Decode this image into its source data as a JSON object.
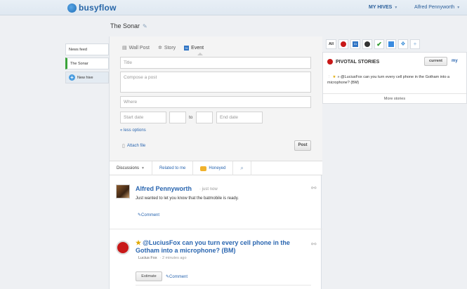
{
  "app": {
    "name": "busyflow"
  },
  "topbar": {
    "hives_label": "MY HIVES",
    "user_name": "Alfred Pennyworth"
  },
  "hive": {
    "title": "The Sonar"
  },
  "sidebar": {
    "items": [
      {
        "label": "News feed"
      },
      {
        "label": "The Sonar"
      },
      {
        "label": "New hive"
      }
    ]
  },
  "composer": {
    "tabs": [
      {
        "label": "Wall Post"
      },
      {
        "label": "Story"
      },
      {
        "label": "Event"
      }
    ],
    "title_placeholder": "Title",
    "compose_placeholder": "Compose a post",
    "where_placeholder": "Where",
    "start_date_placeholder": "Start date",
    "to_label": "to",
    "end_date_placeholder": "End date",
    "less_options": "« less options",
    "attach_label": "Attach file",
    "post_label": "Post",
    "event_icon_text": "31"
  },
  "discussion_tabs": [
    {
      "label": "Discussions"
    },
    {
      "label": "Related to me"
    },
    {
      "label": "Honeyed"
    }
  ],
  "posts": [
    {
      "author": "Alfred Pennyworth",
      "time": "· just now",
      "text": "Just wanted to let you know that the batmobile is ready.",
      "comment_label": "Comment"
    },
    {
      "title": "@LuciusFox can you turn every cell phone in the Gotham into a microphone? (BM)",
      "source": "Lucius Fox",
      "time": "· 2 minutes ago",
      "estimate_label": "Estimate",
      "comment_label": "Comment"
    }
  ],
  "right_panel": {
    "tabs": [
      {
        "label": "All"
      },
      {
        "icon": "pivotal-icon"
      },
      {
        "icon": "calendar-icon",
        "text": "31"
      },
      {
        "icon": "github-icon"
      },
      {
        "icon": "check-icon"
      },
      {
        "icon": "document-icon"
      },
      {
        "icon": "dropbox-icon"
      },
      {
        "icon": "plus-icon"
      }
    ],
    "title": "PIVOTAL STORIES",
    "current_label": "current",
    "my_label": "my",
    "story_text": "» @LuciusFox can you turn every cell phone in the Gotham into a microphone? (BM)",
    "more_label": "More stories"
  },
  "colors": {
    "accent": "#2a66b0",
    "brand": "#2766a8",
    "pivotal_red": "#c81818",
    "active_green": "#3aa33a"
  }
}
